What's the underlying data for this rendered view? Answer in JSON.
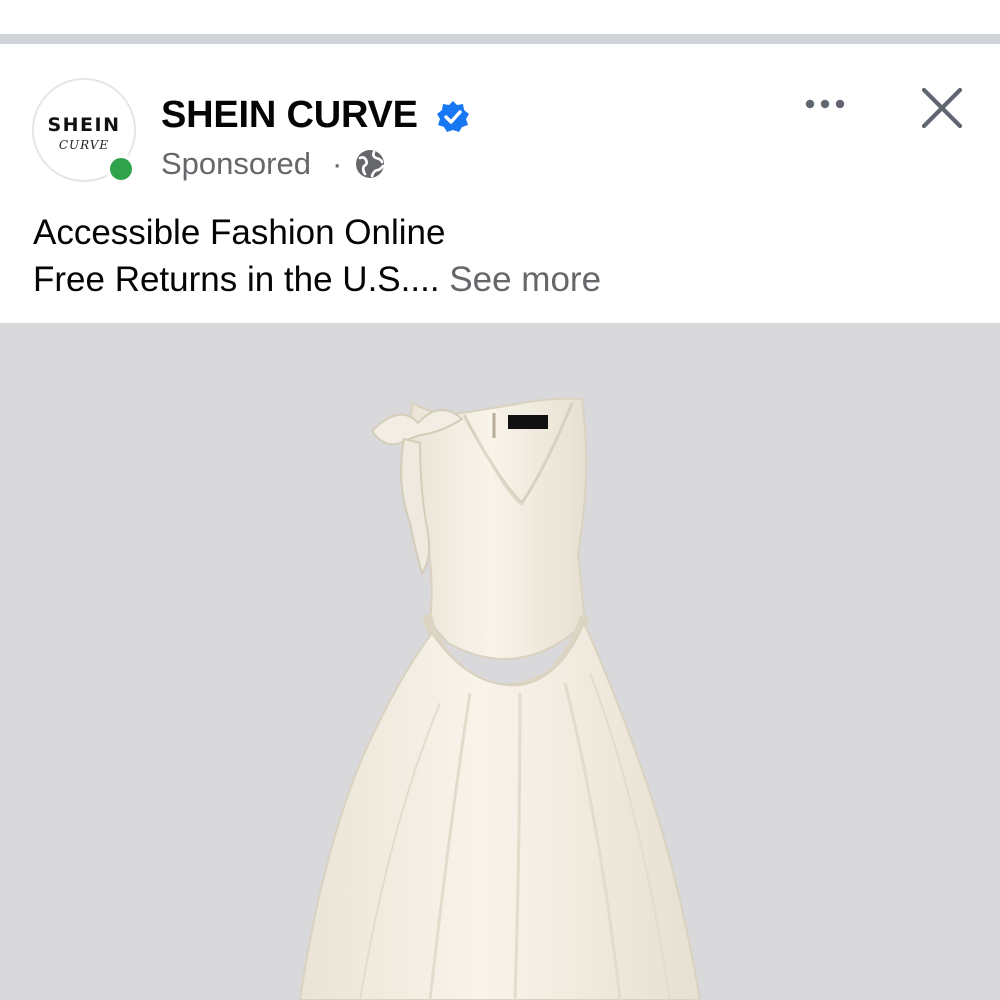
{
  "post": {
    "page_name": "SHEIN CURVE",
    "sponsored_label": "Sponsored",
    "separator": "·",
    "avatar": {
      "brand": "SHEIN",
      "sub": "CURVE"
    },
    "caption": {
      "line1": "Accessible Fashion Online",
      "line2": "Free Returns in the U.S....",
      "see_more": "See more"
    },
    "icons": {
      "verified": "verified-badge-icon",
      "audience": "globe-icon",
      "more": "more-options-icon",
      "close": "close-icon",
      "online": "online-status-dot"
    }
  },
  "colors": {
    "verified_blue": "#1877f2",
    "online_green": "#31a24c",
    "secondary_text": "#65676b",
    "divider": "#cfd2d6",
    "image_background": "#d9d8db"
  }
}
